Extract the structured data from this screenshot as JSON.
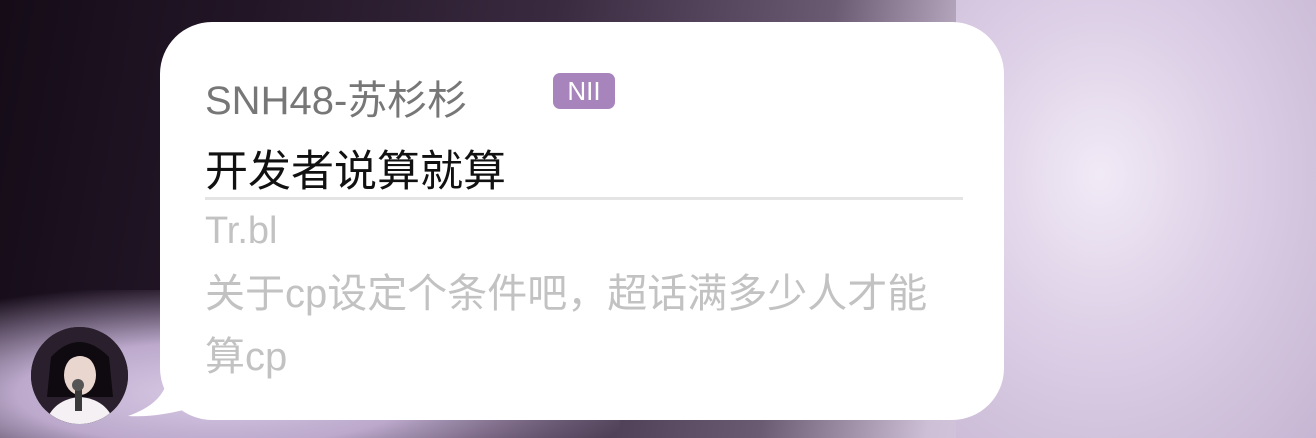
{
  "comment": {
    "sender_name": "SNH48-苏杉杉",
    "team_badge": "NII",
    "message": "开发者说算就算",
    "quoted": {
      "author": "Tr.bl",
      "text": "关于cp设定个条件吧，超话满多少人才能算cp"
    }
  },
  "colors": {
    "badge": "#a884bd",
    "bubble": "#ffffff",
    "quote_text": "#c2c2c2"
  }
}
